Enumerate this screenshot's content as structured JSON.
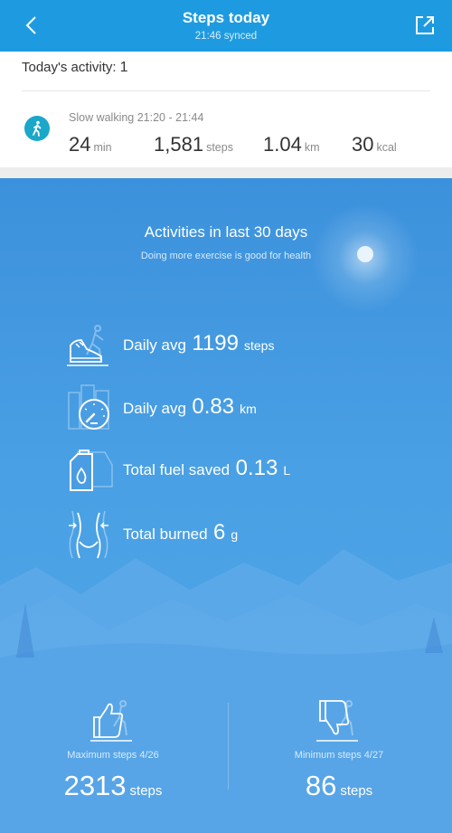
{
  "header": {
    "title": "Steps today",
    "subtitle": "21:46 synced"
  },
  "today": {
    "label": "Today's activity:",
    "count": "1"
  },
  "activity": {
    "title": "Slow walking 21:20 - 21:44",
    "duration": {
      "value": "24",
      "unit": "min"
    },
    "steps": {
      "value": "1,581",
      "unit": "steps"
    },
    "distance": {
      "value": "1.04",
      "unit": "km"
    },
    "calories": {
      "value": "30",
      "unit": "kcal"
    }
  },
  "summary": {
    "title": "Activities in last 30 days",
    "subtitle": "Doing more exercise is good for health",
    "metrics": [
      {
        "label": "Daily avg",
        "value": "1199",
        "unit": "steps",
        "icon": "shoe-icon"
      },
      {
        "label": "Daily avg",
        "value": "0.83",
        "unit": "km",
        "icon": "speedometer-icon"
      },
      {
        "label": "Total fuel saved",
        "value": "0.13",
        "unit": "L",
        "icon": "fuel-can-icon"
      },
      {
        "label": "Total burned",
        "value": "6",
        "unit": "g",
        "icon": "waist-icon"
      }
    ]
  },
  "extremes": {
    "max": {
      "label": "Maximum steps 4/26",
      "value": "2313",
      "unit": "steps",
      "icon": "thumbs-up-icon"
    },
    "min": {
      "label": "Minimum steps 4/27",
      "value": "86",
      "unit": "steps",
      "icon": "thumbs-down-icon"
    }
  },
  "colors": {
    "header": "#1e9be0",
    "accent": "#1aa7c9",
    "panel": "#4aa0e4"
  }
}
